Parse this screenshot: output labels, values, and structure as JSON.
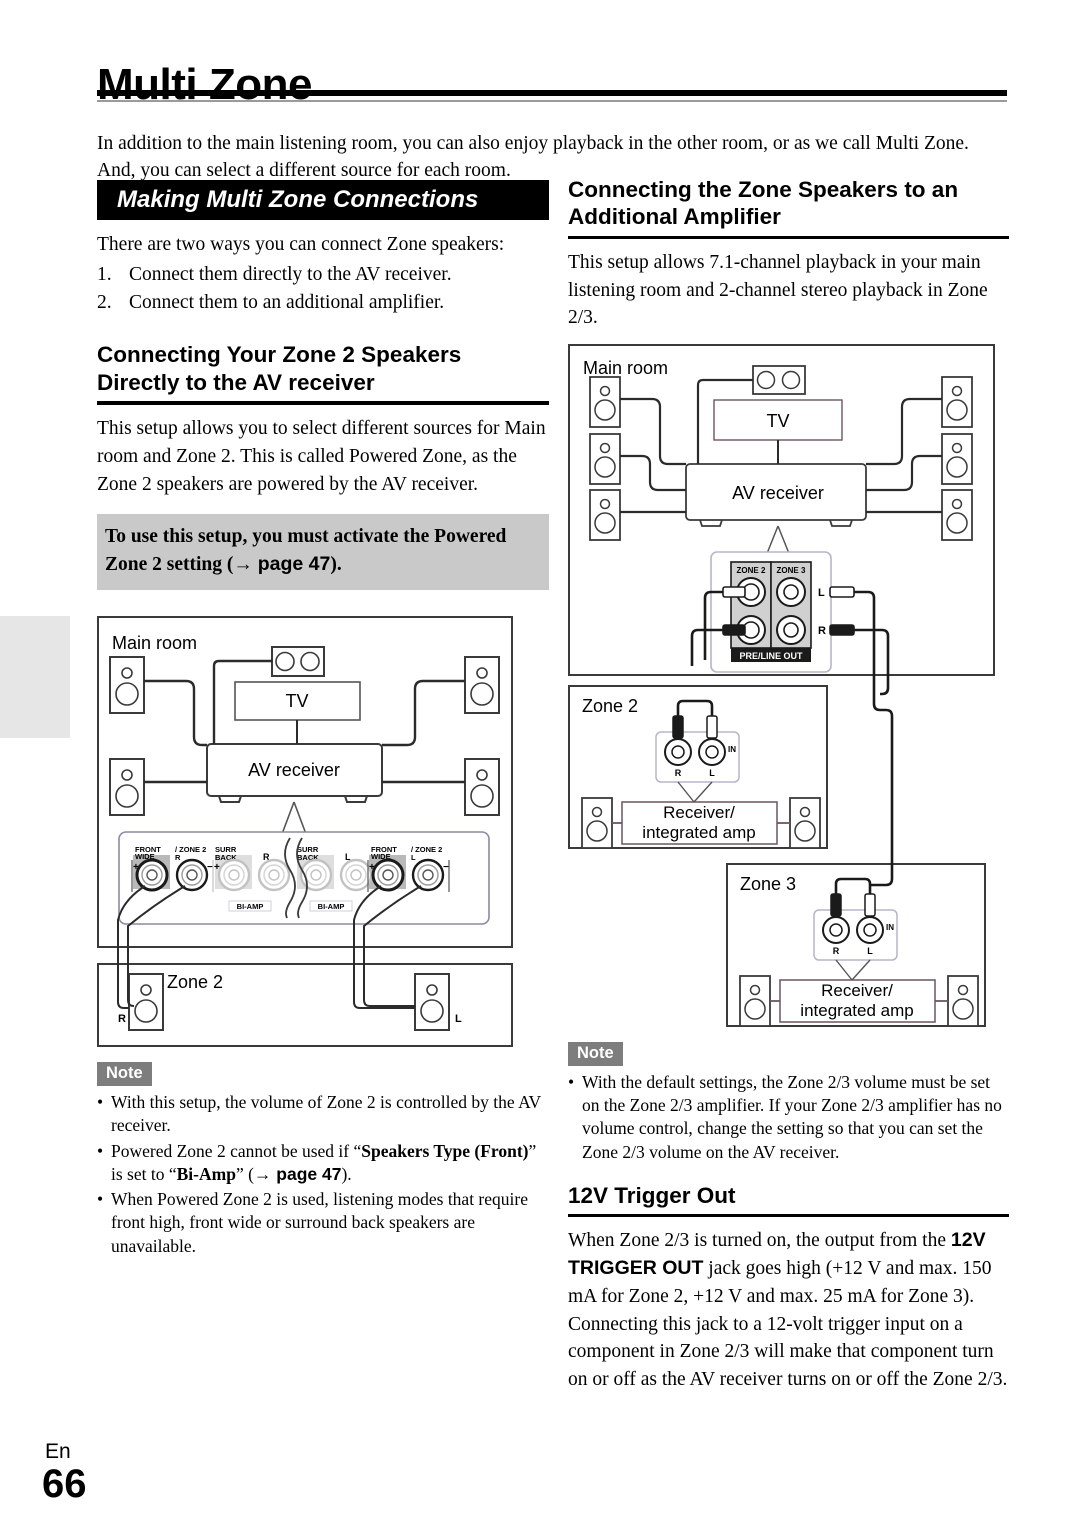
{
  "page": {
    "chapter_title": "Multi Zone",
    "intro": "In addition to the main listening room, you can also enjoy playback in the other room, or as we call Multi Zone. And, you can select a different source for each room.",
    "footer_lang": "En",
    "footer_number": "66"
  },
  "left_column": {
    "section_bar": "Making Multi Zone Connections",
    "lead": "There are two ways you can connect Zone speakers:",
    "numbered_items": [
      {
        "num": "1.",
        "text": "Connect them directly to the AV receiver."
      },
      {
        "num": "2.",
        "text": "Connect them to an additional amplifier."
      }
    ],
    "heading": "Connecting Your Zone 2 Speakers Directly to the AV receiver",
    "paragraph": "This setup allows you to select different sources for Main room and Zone 2. This is called Powered Zone, as the Zone 2 speakers are powered by the AV receiver.",
    "callout": {
      "line1": "To use this setup, you must activate the Powered",
      "line2_pre": "Zone 2 setting (",
      "arrow": "→",
      "page_ref": "page 47",
      "line2_post": ")."
    },
    "note": {
      "label": "Note",
      "items": [
        "With this setup, the volume of Zone 2 is controlled by the AV receiver.",
        "Powered Zone 2 cannot be used if “Speakers Type (Front)” is set to “Bi-Amp” (→ page 47).",
        "When Powered Zone 2 is used, listening modes that require front high, front wide or surround back speakers are unavailable."
      ],
      "item2_parts": {
        "a": "Powered Zone 2 cannot be used if “",
        "b": "Speakers Type (Front)",
        "c": "” is set to “",
        "d": "Bi-Amp",
        "e": "” (",
        "f": "→ page 47",
        "g": ")."
      }
    }
  },
  "right_column": {
    "heading": "Connecting the Zone Speakers to an Additional Amplifier",
    "paragraph": "This setup allows 7.1-channel playback in your main listening room and 2-channel stereo playback in Zone 2/3.",
    "note": {
      "label": "Note",
      "items": [
        "With the default settings, the Zone 2/3 volume must be set on the Zone 2/3 amplifier. If your Zone 2/3 amplifier has no volume control, change the setting so that you can set the Zone 2/3 volume on the AV receiver."
      ]
    },
    "trigger_heading": "12V Trigger Out",
    "trigger_paragraph_parts": {
      "a": "When Zone 2/3 is turned on, the output from the ",
      "b": "12V TRIGGER OUT",
      "c": " jack goes high (+12 V and max. 150 mA for Zone 2, +12 V and max. 25 mA for Zone 3). Connecting this jack to a 12-volt trigger input on a component in Zone 2/3 will make that component turn on or off as the AV receiver turns on or off the Zone 2/3."
    }
  },
  "diagram_left": {
    "room_label": "Main room",
    "tv_label": "TV",
    "receiver_label": "AV receiver",
    "zone_label": "Zone 2",
    "zone_speaker_r": "R",
    "zone_speaker_l": "L",
    "terminals": [
      {
        "top": "FRONT",
        "top2": "WIDE",
        "sign": "+",
        "active": true
      },
      {
        "top": "/ ZONE 2",
        "top2": "R",
        "sign": "−",
        "active": true
      },
      {
        "top": "SURR",
        "top2": "BACK",
        "sign": "+",
        "active": false
      },
      {
        "top": "",
        "top2": "R",
        "sign": "",
        "active": false
      },
      {
        "top": "SURR",
        "top2": "BACK",
        "sign": "",
        "active": false
      },
      {
        "top": "",
        "top2": "L",
        "sign": "−",
        "active": false
      },
      {
        "top": "FRONT",
        "top2": "WIDE",
        "sign": "+",
        "active": true
      },
      {
        "top": "/ ZONE 2",
        "top2": "L",
        "sign": "−",
        "active": true
      }
    ],
    "biamp_label": "BI-AMP"
  },
  "diagram_right": {
    "main_room_label": "Main room",
    "tv_label": "TV",
    "receiver_label": "AV receiver",
    "jack_panel": {
      "zone2_label": "ZONE 2",
      "zone3_label": "ZONE 3",
      "bottom_label": "PRE/LINE OUT",
      "l_label": "L",
      "r_label": "R"
    },
    "zone2": {
      "title": "Zone 2",
      "in_label": "IN",
      "r_label": "R",
      "l_label": "L",
      "amp_line1": "Receiver/",
      "amp_line2": "integrated amp"
    },
    "zone3": {
      "title": "Zone 3",
      "in_label": "IN",
      "r_label": "R",
      "l_label": "L",
      "amp_line1": "Receiver/",
      "amp_line2": "integrated amp"
    }
  }
}
